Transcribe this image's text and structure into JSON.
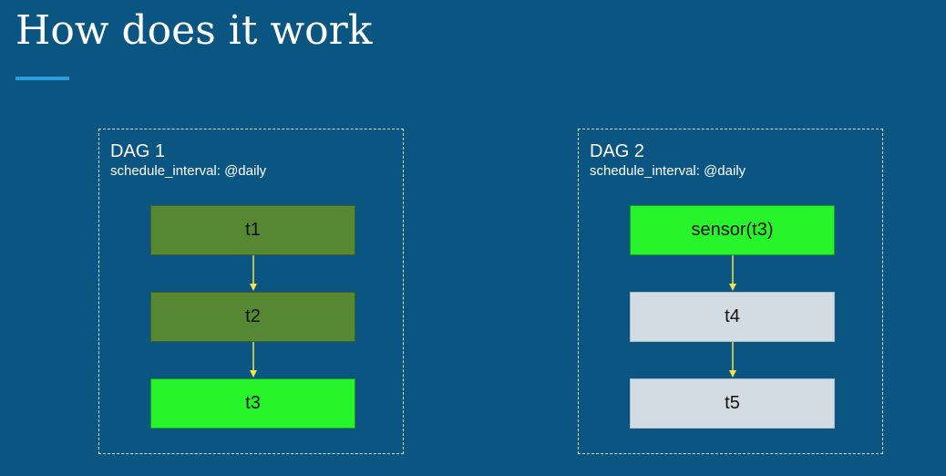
{
  "slide": {
    "title": "How does it work"
  },
  "colors": {
    "background": "#0b5582",
    "accent_underline": "#2d9cdb",
    "task_done": "#568833",
    "task_highlight": "#27f42a",
    "task_pending": "#d3dce2",
    "arrow": "#f2e34a"
  },
  "dags": [
    {
      "name": "DAG 1",
      "schedule": "schedule_interval: @daily",
      "tasks": [
        "t1",
        "t2",
        "t3"
      ],
      "edges": [
        [
          "t1",
          "t2"
        ],
        [
          "t2",
          "t3"
        ]
      ]
    },
    {
      "name": "DAG 2",
      "schedule": "schedule_interval: @daily",
      "tasks": [
        "sensor(t3)",
        "t4",
        "t5"
      ],
      "edges": [
        [
          "sensor(t3)",
          "t4"
        ],
        [
          "t4",
          "t5"
        ]
      ]
    }
  ]
}
